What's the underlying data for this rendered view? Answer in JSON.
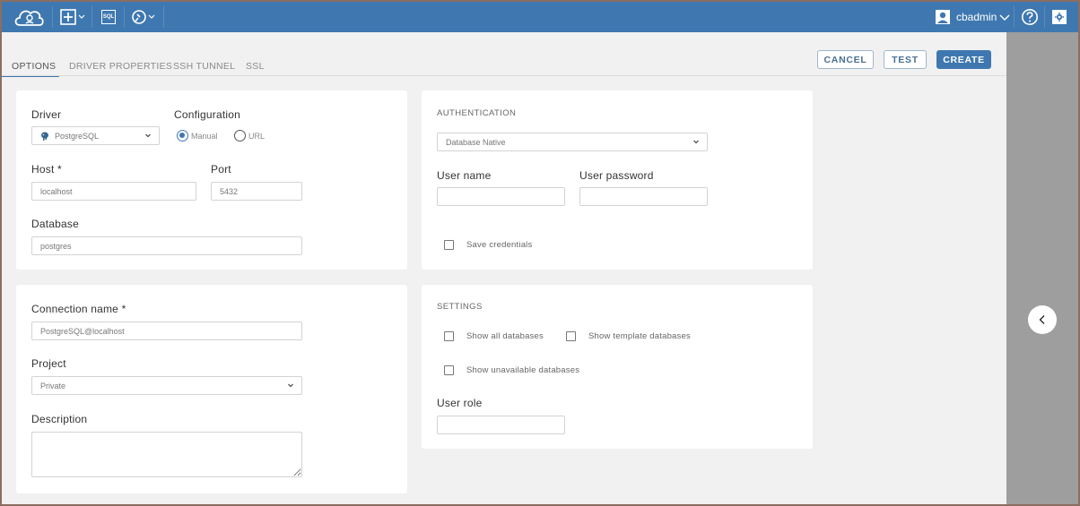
{
  "topbar": {
    "logo_icon": "cloudbeaver-logo-icon",
    "new_icon": "plus-box-icon",
    "sql_label": "SQL",
    "tools_icon": "wrench-icon",
    "user_name": "cbadmin",
    "help_icon": "question-circle-icon",
    "settings_icon": "gear-icon"
  },
  "tabs": [
    {
      "label": "OPTIONS",
      "active": true
    },
    {
      "label": "DRIVER PROPERTIES",
      "active": false
    },
    {
      "label": "SSH TUNNEL",
      "active": false
    },
    {
      "label": "SSL",
      "active": false
    }
  ],
  "actions": {
    "cancel": "CANCEL",
    "test": "TEST",
    "create": "CREATE"
  },
  "connection": {
    "driver_label": "Driver",
    "driver_value": "PostgreSQL",
    "configuration_label": "Configuration",
    "config_options": [
      {
        "label": "Manual",
        "selected": true
      },
      {
        "label": "URL",
        "selected": false
      }
    ],
    "host_label": "Host *",
    "host_value": "localhost",
    "port_label": "Port",
    "port_value": "5432",
    "database_label": "Database",
    "database_value": "postgres"
  },
  "general": {
    "connection_name_label": "Connection name *",
    "connection_name_value": "PostgreSQL@localhost",
    "project_label": "Project",
    "project_value": "Private",
    "description_label": "Description",
    "description_value": ""
  },
  "authentication": {
    "title": "AUTHENTICATION",
    "method_value": "Database Native",
    "user_name_label": "User name",
    "user_name_value": "",
    "user_password_label": "User password",
    "user_password_value": "",
    "save_credentials_label": "Save credentials",
    "save_credentials_checked": false
  },
  "settings": {
    "title": "SETTINGS",
    "show_all_databases": "Show all databases",
    "show_template_databases": "Show template databases",
    "show_unavailable_databases": "Show unavailable databases",
    "user_role_label": "User role",
    "user_role_value": ""
  },
  "colors": {
    "brand": "#3f78b0",
    "background": "#f1f1f1",
    "side_panel": "#9e9e9e"
  }
}
